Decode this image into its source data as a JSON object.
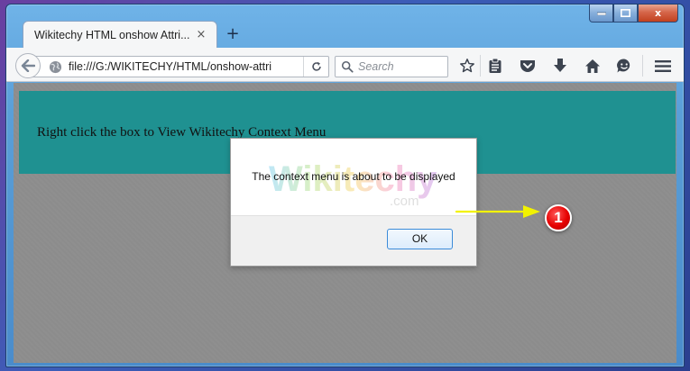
{
  "browser": {
    "tab_title": "Wikitechy HTML onshow Attri...",
    "tab_close_glyph": "×",
    "new_tab_glyph": "+",
    "url": "file:///G:/WIKITECHY/HTML/onshow-attri",
    "search_placeholder": "Search",
    "icons": [
      "back-arrow-icon",
      "globe-icon",
      "reload-icon",
      "search-icon",
      "bookmark-star-icon",
      "reading-list-icon",
      "pocket-icon",
      "download-icon",
      "home-icon",
      "hello-chat-icon",
      "menu-hamburger-icon"
    ]
  },
  "window_controls": {
    "minimize": "minimize",
    "maximize": "maximize",
    "close_glyph": "x"
  },
  "page": {
    "menu_box_text": "Right click the box to View Wikitechy Context Menu"
  },
  "dialog": {
    "message": "The context menu  is about to be displayed",
    "ok_label": "OK",
    "watermark_logo": "Wikitechy",
    "watermark_suffix": ".com"
  },
  "annotation": {
    "callout_number": "1"
  },
  "colors": {
    "menu_box_bg": "#1f9191",
    "content_bg": "#8c8c8c",
    "callout_red": "#e60000",
    "arrow_yellow": "#f2f200"
  }
}
